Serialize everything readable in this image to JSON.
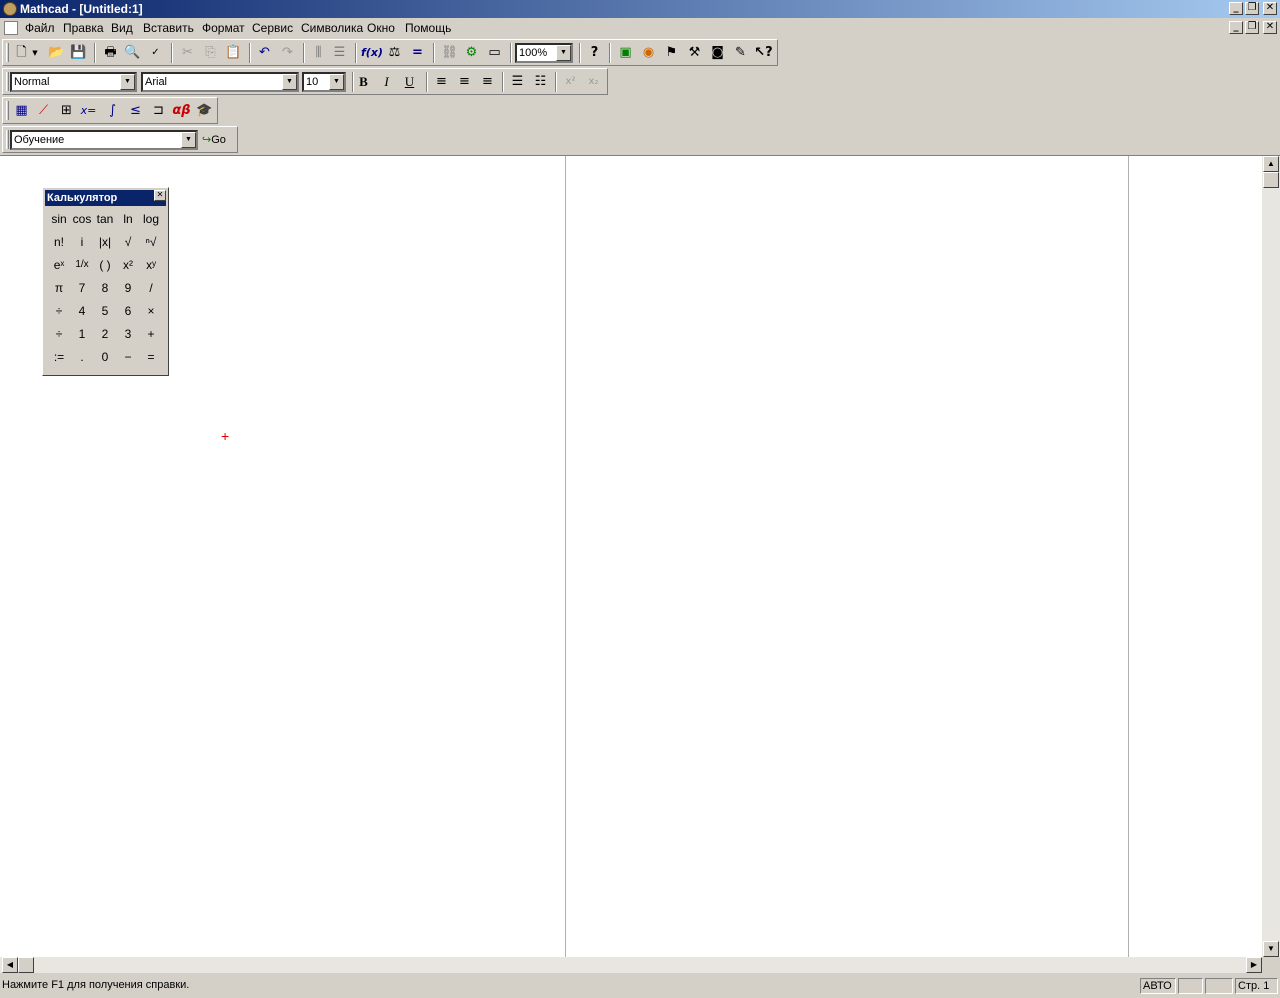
{
  "window": {
    "title": "Mathcad - [Untitled:1]"
  },
  "menu": [
    "Файл",
    "Правка",
    "Вид",
    "Вставить",
    "Формат",
    "Сервис",
    "Символика",
    "Окно",
    "Помощь"
  ],
  "format_toolbar": {
    "style": "Normal",
    "font": "Arial",
    "size": "10"
  },
  "standard_toolbar": {
    "zoom": "100%"
  },
  "resources_toolbar": {
    "selection": "Обучение",
    "go_label": "Go"
  },
  "calculator": {
    "title": "Калькулятор",
    "rows": [
      [
        "sin",
        "cos",
        "tan",
        "ln",
        "log"
      ],
      [
        "n!",
        "i",
        "|x|",
        "√",
        "ⁿ√"
      ],
      [
        "eˣ",
        "1/x",
        "( )",
        "x²",
        "xʸ"
      ],
      [
        "π",
        "7",
        "8",
        "9",
        "/"
      ],
      [
        "÷",
        "4",
        "5",
        "6",
        "×"
      ],
      [
        "÷",
        "1",
        "2",
        "3",
        "+"
      ],
      [
        ":=",
        ".",
        "0",
        "−",
        "="
      ]
    ]
  },
  "status": {
    "help": "Нажмите F1 для получения справки.",
    "mode": "АВТО",
    "page": "Стр. 1"
  }
}
